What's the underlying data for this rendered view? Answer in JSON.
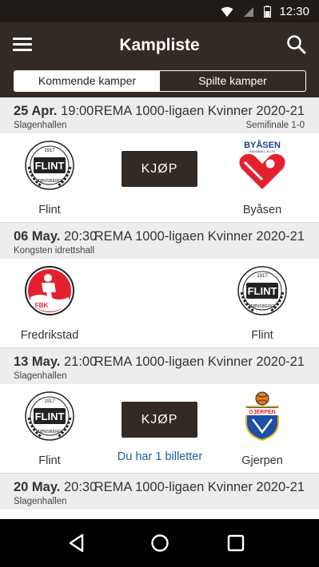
{
  "status_bar": {
    "time": "12:30",
    "icons": [
      "wifi-icon",
      "signal-icon",
      "battery-icon"
    ]
  },
  "app_bar": {
    "title": "Kampliste",
    "menu_icon": "menu-icon",
    "search_icon": "search-icon"
  },
  "tabs": [
    {
      "label": "Kommende kamper",
      "active": true
    },
    {
      "label": "Spilte kamper",
      "active": false
    }
  ],
  "matches": [
    {
      "date": "25 Apr.",
      "time": "19:00",
      "league": "REMA 1000-ligaen Kvinner 2020-21",
      "venue": "Slagenhallen",
      "stage": "Semifinale 1-0",
      "home": {
        "name": "Flint",
        "logo": "flint-logo"
      },
      "away": {
        "name": "Byåsen",
        "logo": "byasen-logo",
        "logo_text": "BYÅSEN",
        "logo_subtext": "HÅNDBALL ELITE"
      },
      "buy_label": "KJØP",
      "tickets": ""
    },
    {
      "date": "06 May.",
      "time": "20:30",
      "league": "REMA 1000-ligaen Kvinner 2020-21",
      "venue": "Kongsten idrettshall",
      "stage": "",
      "home": {
        "name": "Fredrikstad",
        "logo": "fredrikstad-logo",
        "logo_text": "FBK"
      },
      "away": {
        "name": "Flint",
        "logo": "flint-logo"
      },
      "buy_label": "",
      "tickets": ""
    },
    {
      "date": "13 May.",
      "time": "21:00",
      "league": "REMA 1000-ligaen Kvinner 2020-21",
      "venue": "Slagenhallen",
      "stage": "",
      "home": {
        "name": "Flint",
        "logo": "flint-logo"
      },
      "away": {
        "name": "Gjerpen",
        "logo": "gjerpen-logo",
        "logo_text": "GJERPEN"
      },
      "buy_label": "KJØP",
      "tickets": "Du har 1 billetter"
    },
    {
      "date": "20 May.",
      "time": "20:30",
      "league": "REMA 1000-ligaen Kvinner 2020-21",
      "venue": "Slagenhallen",
      "stage": ""
    }
  ],
  "flint_logo": {
    "text": "FLINT",
    "year": "1917",
    "city": "TØNSBERG"
  },
  "nav_bar": {
    "icons": [
      "back-icon",
      "home-icon",
      "recents-icon"
    ]
  },
  "colors": {
    "app_bar": "#322a25",
    "status_bar": "#1f1b18",
    "header_bg": "#ededed",
    "link": "#1a5fa8",
    "byasen_red": "#e5202e"
  }
}
